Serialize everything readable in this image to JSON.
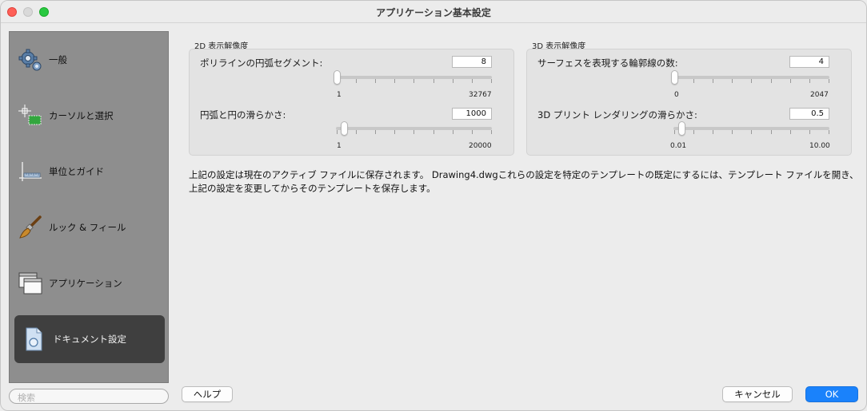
{
  "window": {
    "title": "アプリケーション基本設定"
  },
  "sidebar": {
    "items": [
      {
        "label": "一般",
        "icon": "gear-icon"
      },
      {
        "label": "カーソルと選択",
        "icon": "cursor-selection-icon"
      },
      {
        "label": "単位とガイド",
        "icon": "ruler-icon"
      },
      {
        "label": "ルック & フィール",
        "icon": "paintbrush-icon"
      },
      {
        "label": "アプリケーション",
        "icon": "windows-icon"
      },
      {
        "label": "ドキュメント設定",
        "icon": "document-icon",
        "selected": true
      }
    ],
    "search_placeholder": "検索"
  },
  "display2d": {
    "title": "2D 表示解像度",
    "polyline": {
      "label": "ポリラインの円弧セグメント:",
      "value": "8",
      "min": "1",
      "max": "32767",
      "level": 0.0
    },
    "arc": {
      "label": "円弧と円の滑らかさ:",
      "value": "1000",
      "min": "1",
      "max": "20000",
      "level": 0.05
    }
  },
  "display3d": {
    "title": "3D 表示解像度",
    "contour": {
      "label": "サーフェスを表現する輪郭線の数:",
      "value": "4",
      "min": "0",
      "max": "2047",
      "level": 0.0
    },
    "print": {
      "label": "3D プリント レンダリングの滑らかさ:",
      "value": "0.5",
      "min": "0.01",
      "max": "10.00",
      "level": 0.05
    }
  },
  "info_text": "上記の設定は現在のアクティブ ファイルに保存されます。 Drawing4.dwgこれらの設定を特定のテンプレートの既定にするには、テンプレート ファイルを開き、上記の設定を変更してからそのテンプレートを保存します。",
  "buttons": {
    "help": "ヘルプ",
    "cancel": "キャンセル",
    "ok": "OK"
  },
  "colors": {
    "accent": "#1a82fb",
    "sidebar": "#8e8e8e",
    "selected": "#3f3f3f"
  }
}
